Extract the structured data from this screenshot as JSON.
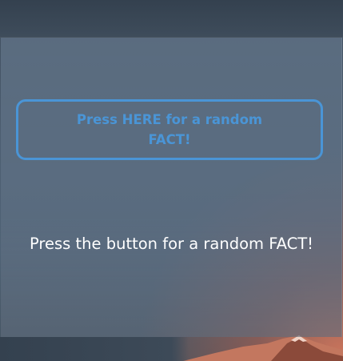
{
  "button": {
    "label": "Press HERE for a random FACT!"
  },
  "fact": {
    "text": "Press the button for a random FACT!"
  },
  "colors": {
    "accent": "#4a95d6",
    "text": "#ffffff"
  }
}
